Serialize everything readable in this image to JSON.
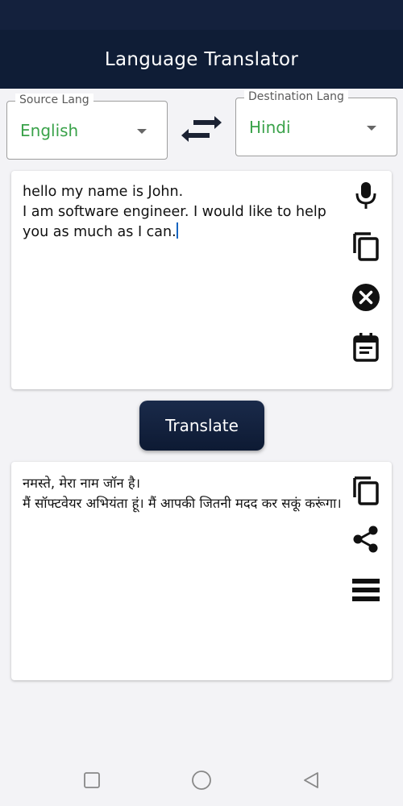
{
  "app": {
    "title": "Language Translator"
  },
  "source": {
    "legend": "Source Lang",
    "value": "English"
  },
  "destination": {
    "legend": "Destination Lang",
    "value": "Hindi"
  },
  "input": {
    "text": "hello my name is John.\nI am software engineer. I would like to help you as much as I can."
  },
  "output": {
    "text": "नमस्ते, मेरा नाम जॉन है।\nमैं सॉफ्टवेयर अभियंता हूं। मैं आपकी जितनी मदद कर सकूं करूंगा।"
  },
  "translate_button": {
    "label": "Translate"
  },
  "icons": {
    "swap": "swap-arrows-icon",
    "mic": "mic-icon",
    "copy": "copy-icon",
    "clear": "close-circle-icon",
    "notes": "calendar-icon",
    "share": "share-icon",
    "list": "list-icon"
  },
  "colors": {
    "primary": "#0f1d36",
    "language_text": "#3aa24a",
    "background": "#f3f3f6"
  }
}
